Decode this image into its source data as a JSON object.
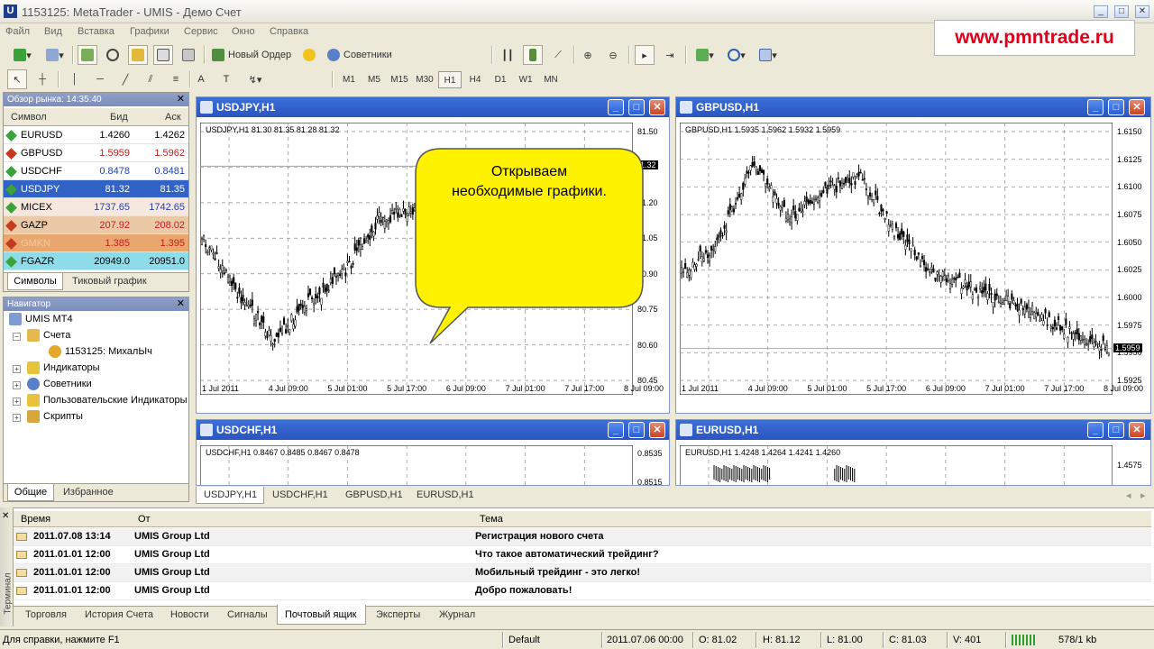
{
  "window": {
    "icon_letter": "U",
    "title": "1153125: MetaTrader - UMIS - Демо Счет"
  },
  "menu": [
    "Файл",
    "Вид",
    "Вставка",
    "Графики",
    "Сервис",
    "Окно",
    "Справка"
  ],
  "toolbar": {
    "new_order": "Новый Ордер",
    "experts": "Советники"
  },
  "timeframes": [
    "M1",
    "M5",
    "M15",
    "M30",
    "H1",
    "H4",
    "D1",
    "W1",
    "MN"
  ],
  "selected_timeframe": "H1",
  "watermark": "www.pmntrade.ru",
  "market_watch": {
    "title": "Обзор рынка: 14:35:40",
    "headers": {
      "symbol": "Символ",
      "bid": "Бид",
      "ask": "Аск"
    },
    "rows": [
      {
        "symbol": "EURUSD",
        "bid": "1.4260",
        "ask": "1.4262"
      },
      {
        "symbol": "GBPUSD",
        "bid": "1.5959",
        "ask": "1.5962"
      },
      {
        "symbol": "USDCHF",
        "bid": "0.8478",
        "ask": "0.8481"
      },
      {
        "symbol": "USDJPY",
        "bid": "81.32",
        "ask": "81.35"
      },
      {
        "symbol": "MICEX",
        "bid": "1737.65",
        "ask": "1742.65"
      },
      {
        "symbol": "GAZP",
        "bid": "207.92",
        "ask": "208.02"
      },
      {
        "symbol": "GMKN",
        "bid": "1.385",
        "ask": "1.395"
      },
      {
        "symbol": "FGAZR",
        "bid": "20949.0",
        "ask": "20951.0"
      }
    ],
    "tabs": [
      "Символы",
      "Тиковый график"
    ]
  },
  "navigator": {
    "title": "Навигатор",
    "root": "UMIS MT4",
    "accounts": "Счета",
    "account": "1153125: МихалЫч",
    "indicators": "Индикаторы",
    "experts": "Советники",
    "custom_indicators": "Пользовательские Индикаторы",
    "scripts": "Скрипты",
    "tabs": [
      "Общие",
      "Избранное"
    ]
  },
  "charts": {
    "usdjpy": {
      "title": "USDJPY,H1",
      "info": "USDJPY,H1  81.30 81.35 81.28 81.32",
      "price_marker": "81.32",
      "yticks": [
        "81.50",
        "81.35",
        "81.20",
        "81.05",
        "80.90",
        "80.75",
        "80.60",
        "80.45"
      ],
      "xticks": [
        "1 Jul 2011",
        "4 Jul 09:00",
        "5 Jul 01:00",
        "5 Jul 17:00",
        "6 Jul 09:00",
        "7 Jul 01:00",
        "7 Jul 17:00",
        "8 Jul 09:00"
      ]
    },
    "gbpusd": {
      "title": "GBPUSD,H1",
      "info": "GBPUSD,H1  1.5935 1.5962 1.5932 1.5959",
      "price_marker": "1.5959",
      "yticks": [
        "1.6150",
        "1.6125",
        "1.6100",
        "1.6075",
        "1.6050",
        "1.6025",
        "1.6000",
        "1.5975",
        "1.5950",
        "1.5925"
      ],
      "xticks": [
        "1 Jul 2011",
        "4 Jul 09:00",
        "5 Jul 01:00",
        "5 Jul 17:00",
        "6 Jul 09:00",
        "7 Jul 01:00",
        "7 Jul 17:00",
        "8 Jul 09:00"
      ]
    },
    "usdchf": {
      "title": "USDCHF,H1",
      "info": "USDCHF,H1  0.8467 0.8485 0.8467 0.8478",
      "yticks": [
        "0.8535",
        "0.8515"
      ]
    },
    "eurusd": {
      "title": "EURUSD,H1",
      "info": "EURUSD,H1  1.4248 1.4264 1.4241 1.4260",
      "yticks": [
        "1.4575"
      ]
    }
  },
  "bubble": {
    "line1": "Открываем",
    "line2": "необходимые графики."
  },
  "chart_tabs": [
    "USDJPY,H1",
    "USDCHF,H1",
    "GBPUSD,H1",
    "EURUSD,H1"
  ],
  "terminal": {
    "side_label": "Терминал",
    "headers": {
      "time": "Время",
      "from": "От",
      "subject": "Тема"
    },
    "rows": [
      {
        "time": "2011.07.08 13:14",
        "from": "UMIS Group Ltd",
        "subject": "Регистрация нового счета"
      },
      {
        "time": "2011.01.01 12:00",
        "from": "UMIS Group Ltd",
        "subject": "Что такое автоматический трейдинг?"
      },
      {
        "time": "2011.01.01 12:00",
        "from": "UMIS Group Ltd",
        "subject": "Мобильный трейдинг - это легко!"
      },
      {
        "time": "2011.01.01 12:00",
        "from": "UMIS Group Ltd",
        "subject": "Добро пожаловать!"
      }
    ],
    "tabs": [
      "Торговля",
      "История Счета",
      "Новости",
      "Сигналы",
      "Почтовый ящик",
      "Эксперты",
      "Журнал"
    ],
    "active_tab": "Почтовый ящик"
  },
  "status": {
    "help": "Для справки, нажмите F1",
    "profile": "Default",
    "time": "2011.07.06 00:00",
    "open": "O: 81.02",
    "high": "H: 81.12",
    "low": "L: 81.00",
    "close": "C: 81.03",
    "volume": "V: 401",
    "traffic": "578/1 kb"
  },
  "colors": {
    "chart_title": "#2A55C1",
    "bubble": "#FFF200",
    "selected_row": "#3162C5",
    "watermark": "#E0001B"
  }
}
